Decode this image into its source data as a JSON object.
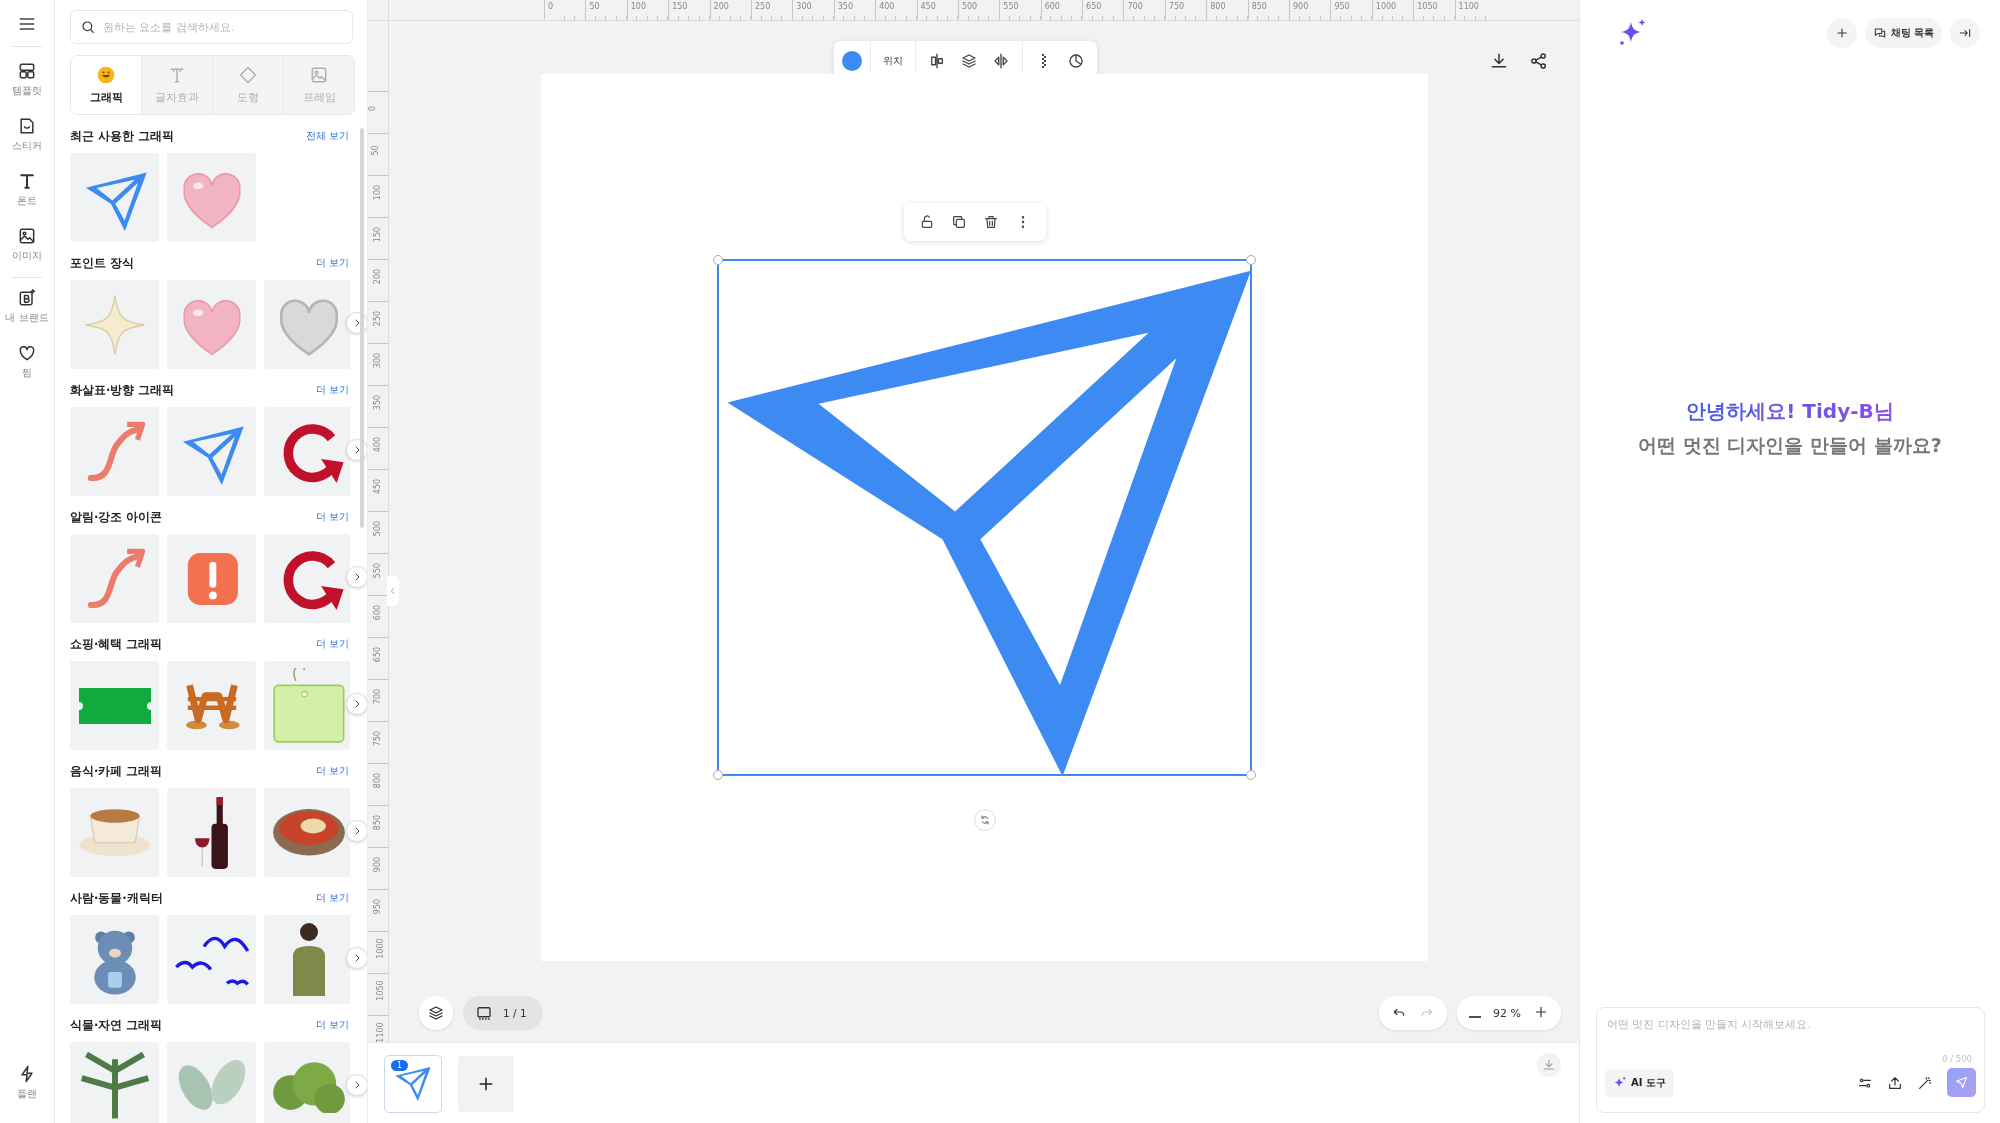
{
  "rail": {
    "items": [
      {
        "label": "템플릿"
      },
      {
        "label": "스티커"
      },
      {
        "label": "폰트"
      },
      {
        "label": "이미지"
      },
      {
        "label": "내 브랜드"
      },
      {
        "label": "찜"
      }
    ],
    "bottom_item": {
      "label": "플랜"
    }
  },
  "panel": {
    "search": {
      "placeholder": "원하는 요소를 검색하세요."
    },
    "tabs": [
      {
        "label": "그래픽",
        "selected": true
      },
      {
        "label": "글자효과",
        "selected": false
      },
      {
        "label": "도형",
        "selected": false
      },
      {
        "label": "프레임",
        "selected": false
      }
    ],
    "sections": [
      {
        "title": "최근 사용한 그래픽",
        "link": "전체 보기",
        "scrollable": false,
        "tiles": [
          {
            "kind": "send-arrow"
          },
          {
            "kind": "heart"
          }
        ]
      },
      {
        "title": "포인트 장식",
        "link": "더 보기",
        "scrollable": true,
        "tiles": [
          {
            "kind": "sparkle"
          },
          {
            "kind": "heart"
          },
          {
            "kind": "silver-heart"
          }
        ]
      },
      {
        "title": "화살표·방향 그래픽",
        "link": "더 보기",
        "scrollable": true,
        "tiles": [
          {
            "kind": "curvy-arrow"
          },
          {
            "kind": "send-arrow"
          },
          {
            "kind": "circular-arrow"
          }
        ]
      },
      {
        "title": "알림·강조 아이콘",
        "link": "더 보기",
        "scrollable": true,
        "tiles": [
          {
            "kind": "curvy-arrow"
          },
          {
            "kind": "alert"
          },
          {
            "kind": "circular-arrow"
          }
        ]
      },
      {
        "title": "쇼핑·혜택 그래픽",
        "link": "더 보기",
        "scrollable": true,
        "tiles": [
          {
            "kind": "ticket"
          },
          {
            "kind": "coins"
          },
          {
            "kind": "tag"
          }
        ]
      },
      {
        "title": "음식·카페 그래픽",
        "link": "더 보기",
        "scrollable": true,
        "tiles": [
          {
            "kind": "coffee"
          },
          {
            "kind": "wine"
          },
          {
            "kind": "bowl"
          }
        ]
      },
      {
        "title": "사람·동물·캐릭터",
        "link": "더 보기",
        "scrollable": true,
        "tiles": [
          {
            "kind": "bear"
          },
          {
            "kind": "birds"
          },
          {
            "kind": "person"
          }
        ]
      },
      {
        "title": "식물·자연 그래픽",
        "link": "더 보기",
        "scrollable": true,
        "tiles": [
          {
            "kind": "fern"
          },
          {
            "kind": "leaves"
          },
          {
            "kind": "bush"
          }
        ]
      }
    ]
  },
  "ruler": {
    "x_labels": [
      "0",
      "50",
      "100",
      "150",
      "200",
      "250",
      "300",
      "350",
      "400",
      "450",
      "500",
      "550",
      "600",
      "650",
      "700",
      "750",
      "800",
      "850",
      "900",
      "950",
      "1000",
      "1050",
      "1100"
    ],
    "y_labels": [
      "0",
      "50",
      "100",
      "150",
      "200",
      "250",
      "300",
      "350",
      "400",
      "450",
      "500",
      "550",
      "600",
      "650",
      "700",
      "750",
      "800",
      "850",
      "900",
      "950",
      "1000",
      "1050",
      "1100"
    ]
  },
  "toolbar": {
    "color": "#3d8bf2",
    "position_label": "위치"
  },
  "canvas": {
    "element": {
      "selected": true
    },
    "page_counter": "1 / 1",
    "zoom": "92 %"
  },
  "pages": [
    {
      "number": "1",
      "selected": true
    }
  ],
  "assistant": {
    "chat_list": "채팅 목록",
    "greeting": "안녕하세요! Tidy-B님",
    "subtitle": "어떤 멋진 디자인을 만들어 볼까요?",
    "input": {
      "placeholder": "어떤 멋진 디자인을 만들지 시작해보세요.",
      "counter": "0 / 500"
    },
    "ai_tools": "AI 도구"
  }
}
